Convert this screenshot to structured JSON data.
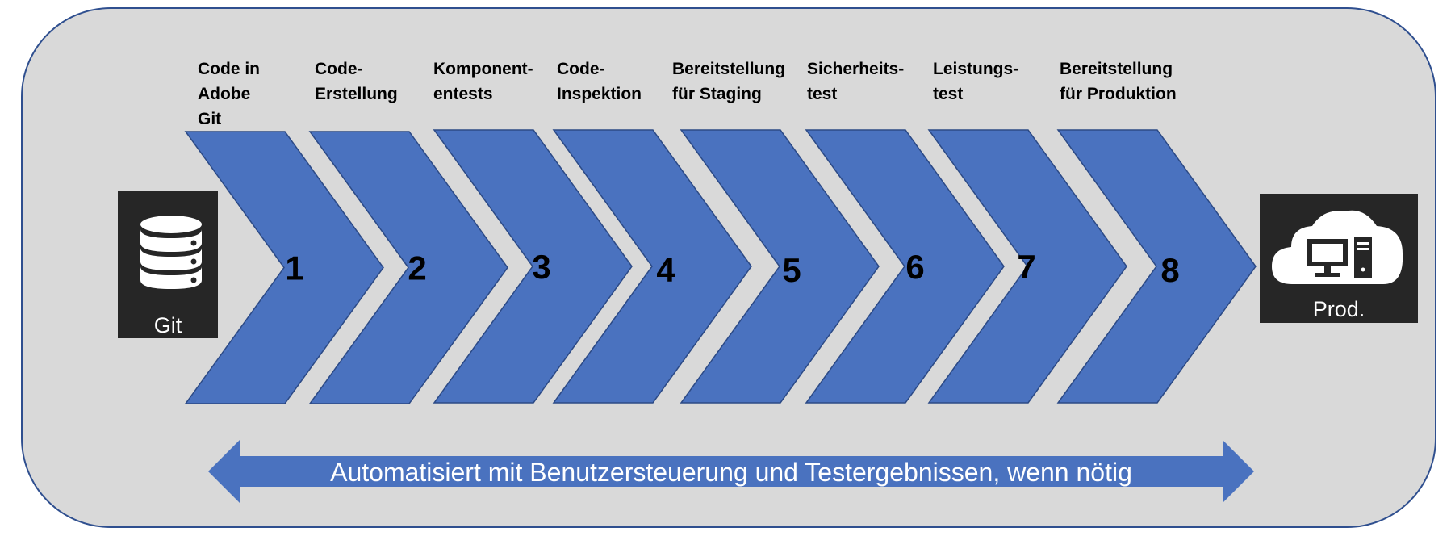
{
  "colors": {
    "background_panel": "#d9d9d9",
    "panel_border": "#2f4f8f",
    "chevron_fill": "#4a72bf",
    "chevron_stroke": "#2c4a86",
    "tile_fill": "#262626",
    "arrow_fill": "#4a72bf"
  },
  "source": {
    "label": "Git",
    "icon": "database-icon"
  },
  "destination": {
    "label": "Prod.",
    "icon": "cloud-computer-icon"
  },
  "steps": [
    {
      "number": "1",
      "label_lines": [
        "Code in",
        "Adobe",
        "Git"
      ]
    },
    {
      "number": "2",
      "label_lines": [
        "Code-",
        "Erstellung"
      ]
    },
    {
      "number": "3",
      "label_lines": [
        "Komponent-",
        "entests"
      ]
    },
    {
      "number": "4",
      "label_lines": [
        "Code-",
        "Inspektion"
      ]
    },
    {
      "number": "5",
      "label_lines": [
        "Bereitstellung",
        "für Staging"
      ]
    },
    {
      "number": "6",
      "label_lines": [
        "Sicherheits-",
        "test"
      ]
    },
    {
      "number": "7",
      "label_lines": [
        "Leistungs-",
        "test"
      ]
    },
    {
      "number": "8",
      "label_lines": [
        "Bereitstellung",
        "für Produktion"
      ]
    }
  ],
  "banner": {
    "text": "Automatisiert mit Benutzersteuerung und Testergebnissen, wenn nötig"
  }
}
